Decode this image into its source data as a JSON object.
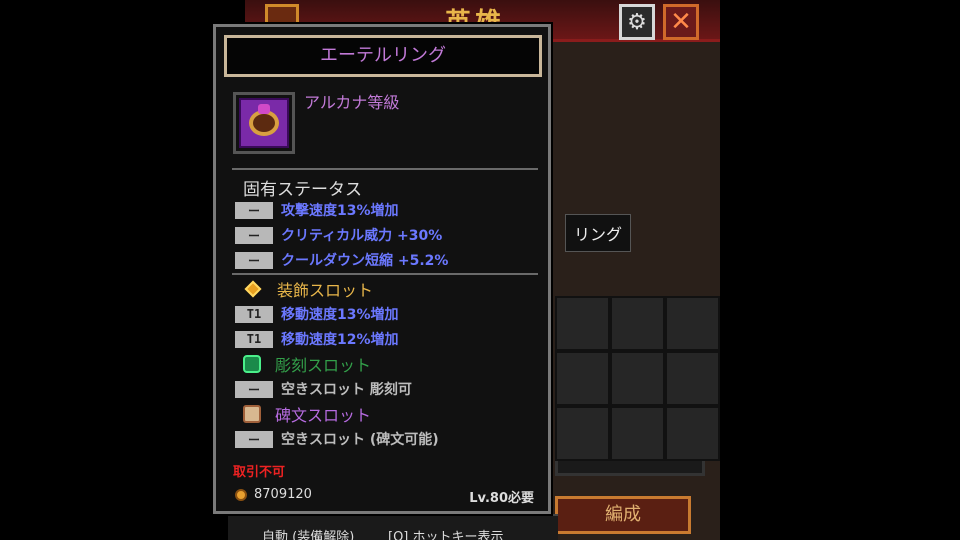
{
  "background": {
    "banner_title": "英雄",
    "formation_button": "編成",
    "ring_tooltip": "リング",
    "bottom_bar": {
      "auto_label": "自動 (装備解除)",
      "hotkey_label": "[Q] ホットキー表示"
    }
  },
  "item": {
    "name": "エーテルリング",
    "grade": "アルカナ等級",
    "intrinsic_header": "固有ステータス",
    "intrinsic_stats": [
      {
        "badge": "ー",
        "text": "攻撃速度13%増加"
      },
      {
        "badge": "ー",
        "text": "クリティカル威力 +30%"
      },
      {
        "badge": "ー",
        "text": "クールダウン短縮 +5.2%"
      }
    ],
    "decoration_slot": {
      "title": "装飾スロット",
      "stats": [
        {
          "badge": "T1",
          "text": "移動速度13%増加"
        },
        {
          "badge": "T1",
          "text": "移動速度12%増加"
        }
      ]
    },
    "engraving_slot": {
      "title": "彫刻スロット",
      "stats": [
        {
          "badge": "ー",
          "text": "空きスロット 彫刻可"
        }
      ]
    },
    "rune_slot": {
      "title": "碑文スロット",
      "stats": [
        {
          "badge": "ー",
          "text": "空きスロット (碑文可能)"
        }
      ]
    },
    "untradable": "取引不可",
    "price": "8709120",
    "level_requirement": "Lv.80必要"
  },
  "icons": {
    "settings": "gear-icon",
    "close": "close-icon",
    "coin": "coin-icon",
    "ring": "ring-icon"
  },
  "colors": {
    "title": "#c27ad8",
    "stat_blue": "#6b78ff",
    "decoration": "#e8b64a",
    "engraving": "#33a04a",
    "rune": "#b66be0",
    "untradable": "#ee2222"
  }
}
